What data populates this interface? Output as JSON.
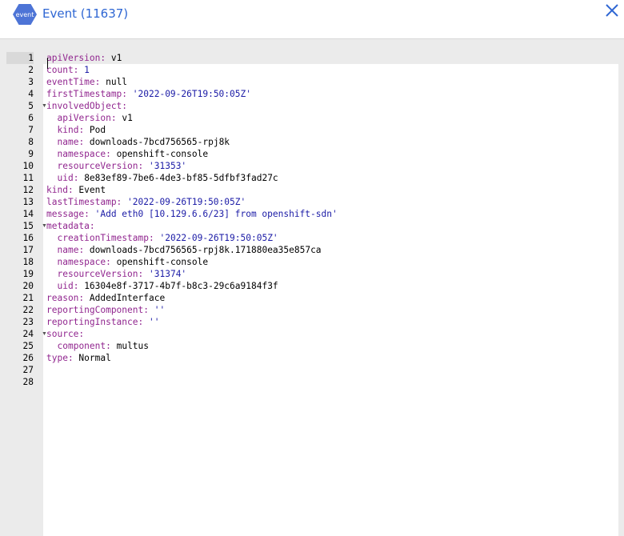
{
  "header": {
    "badge_label": "event",
    "title": "Event (11637)"
  },
  "editor": {
    "lines": [
      {
        "n": "1",
        "indent": 0,
        "key": "apiVersion:",
        "val": " v1",
        "type": "plain",
        "fold": false
      },
      {
        "n": "2",
        "indent": 0,
        "key": "count:",
        "val": " 1",
        "type": "string",
        "fold": false
      },
      {
        "n": "3",
        "indent": 0,
        "key": "eventTime:",
        "val": " null",
        "type": "plain",
        "fold": false
      },
      {
        "n": "4",
        "indent": 0,
        "key": "firstTimestamp:",
        "val": " '2022-09-26T19:50:05Z'",
        "type": "string",
        "fold": false
      },
      {
        "n": "5",
        "indent": 0,
        "key": "involvedObject:",
        "val": "",
        "type": "plain",
        "fold": true
      },
      {
        "n": "6",
        "indent": 2,
        "key": "apiVersion:",
        "val": " v1",
        "type": "plain",
        "fold": false
      },
      {
        "n": "7",
        "indent": 2,
        "key": "kind:",
        "val": " Pod",
        "type": "plain",
        "fold": false
      },
      {
        "n": "8",
        "indent": 2,
        "key": "name:",
        "val": " downloads-7bcd756565-rpj8k",
        "type": "plain",
        "fold": false
      },
      {
        "n": "9",
        "indent": 2,
        "key": "namespace:",
        "val": " openshift-console",
        "type": "plain",
        "fold": false
      },
      {
        "n": "10",
        "indent": 2,
        "key": "resourceVersion:",
        "val": " '31353'",
        "type": "string",
        "fold": false
      },
      {
        "n": "11",
        "indent": 2,
        "key": "uid:",
        "val": " 8e83ef89-7be6-4de3-bf85-5dfbf3fad27c",
        "type": "plain",
        "fold": false
      },
      {
        "n": "12",
        "indent": 0,
        "key": "kind:",
        "val": " Event",
        "type": "plain",
        "fold": false
      },
      {
        "n": "13",
        "indent": 0,
        "key": "lastTimestamp:",
        "val": " '2022-09-26T19:50:05Z'",
        "type": "string",
        "fold": false
      },
      {
        "n": "14",
        "indent": 0,
        "key": "message:",
        "val": " 'Add eth0 [10.129.6.6/23] from openshift-sdn'",
        "type": "string",
        "fold": false
      },
      {
        "n": "15",
        "indent": 0,
        "key": "metadata:",
        "val": "",
        "type": "plain",
        "fold": true
      },
      {
        "n": "16",
        "indent": 2,
        "key": "creationTimestamp:",
        "val": " '2022-09-26T19:50:05Z'",
        "type": "string",
        "fold": false
      },
      {
        "n": "17",
        "indent": 2,
        "key": "name:",
        "val": " downloads-7bcd756565-rpj8k.171880ea35e857ca",
        "type": "plain",
        "fold": false
      },
      {
        "n": "18",
        "indent": 2,
        "key": "namespace:",
        "val": " openshift-console",
        "type": "plain",
        "fold": false
      },
      {
        "n": "19",
        "indent": 2,
        "key": "resourceVersion:",
        "val": " '31374'",
        "type": "string",
        "fold": false
      },
      {
        "n": "20",
        "indent": 2,
        "key": "uid:",
        "val": " 16304e8f-3717-4b7f-b8c3-29c6a9184f3f",
        "type": "plain",
        "fold": false
      },
      {
        "n": "21",
        "indent": 0,
        "key": "reason:",
        "val": " AddedInterface",
        "type": "plain",
        "fold": false
      },
      {
        "n": "22",
        "indent": 0,
        "key": "reportingComponent:",
        "val": " ''",
        "type": "string",
        "fold": false
      },
      {
        "n": "23",
        "indent": 0,
        "key": "reportingInstance:",
        "val": " ''",
        "type": "string",
        "fold": false
      },
      {
        "n": "24",
        "indent": 0,
        "key": "source:",
        "val": "",
        "type": "plain",
        "fold": true
      },
      {
        "n": "25",
        "indent": 2,
        "key": "component:",
        "val": " multus",
        "type": "plain",
        "fold": false
      },
      {
        "n": "26",
        "indent": 0,
        "key": "type:",
        "val": " Normal",
        "type": "plain",
        "fold": false
      },
      {
        "n": "27",
        "indent": 0,
        "key": "",
        "val": "",
        "type": "plain",
        "fold": false
      },
      {
        "n": "28",
        "indent": 0,
        "key": "",
        "val": "",
        "type": "plain",
        "fold": false
      }
    ]
  }
}
